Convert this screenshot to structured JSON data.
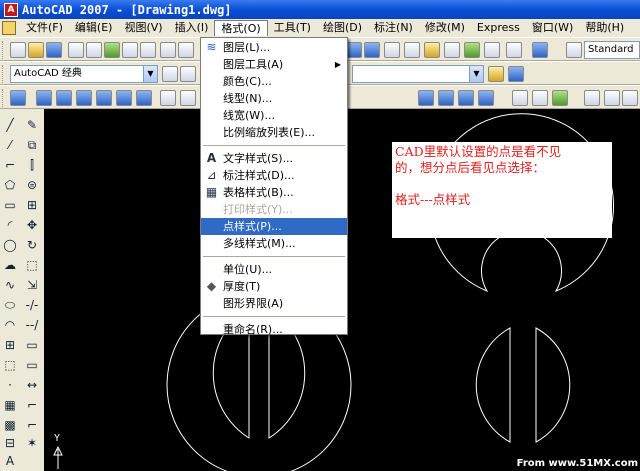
{
  "window": {
    "title": "AutoCAD 2007 - [Drawing1.dwg]"
  },
  "menubar": {
    "items": [
      {
        "label": "文件(F)"
      },
      {
        "label": "编辑(E)"
      },
      {
        "label": "视图(V)"
      },
      {
        "label": "插入(I)"
      },
      {
        "label": "格式(O)"
      },
      {
        "label": "工具(T)"
      },
      {
        "label": "绘图(D)"
      },
      {
        "label": "标注(N)"
      },
      {
        "label": "修改(M)"
      },
      {
        "label": "Express"
      },
      {
        "label": "窗口(W)"
      },
      {
        "label": "帮助(H)"
      }
    ],
    "active_index": 4
  },
  "toolbar": {
    "text_style_combo": "Standard",
    "workspace_combo": "AutoCAD 经典"
  },
  "format_menu": {
    "items": [
      {
        "label": "图层(L)...",
        "icon": "layers-icon",
        "disabled": false
      },
      {
        "label": "图层工具(A)",
        "icon": "",
        "disabled": false,
        "submenu": true
      },
      {
        "label": "颜色(C)...",
        "icon": "",
        "disabled": false
      },
      {
        "label": "线型(N)...",
        "icon": "",
        "disabled": false
      },
      {
        "label": "线宽(W)...",
        "icon": "",
        "disabled": false
      },
      {
        "label": "比例缩放列表(E)...",
        "icon": "",
        "disabled": false
      },
      {
        "label": "文字样式(S)...",
        "icon": "text-style-icon",
        "disabled": false,
        "sep_before": true
      },
      {
        "label": "标注样式(D)...",
        "icon": "dim-style-icon",
        "disabled": false
      },
      {
        "label": "表格样式(B)...",
        "icon": "table-style-icon",
        "disabled": false
      },
      {
        "label": "打印样式(Y)...",
        "icon": "",
        "disabled": true
      },
      {
        "label": "点样式(P)...",
        "icon": "",
        "disabled": false,
        "highlight": true
      },
      {
        "label": "多线样式(M)...",
        "icon": "",
        "disabled": false
      },
      {
        "label": "单位(U)...",
        "icon": "",
        "disabled": false,
        "sep_before": true
      },
      {
        "label": "厚度(T)",
        "icon": "thickness-icon",
        "disabled": false
      },
      {
        "label": "图形界限(A)",
        "icon": "",
        "disabled": false
      },
      {
        "label": "重命名(R)...",
        "icon": "",
        "disabled": false,
        "sep_before": true
      }
    ]
  },
  "annotation": {
    "line1": "CAD里默认设置的点是看不见",
    "line2": "的，想分点后看见点选择：",
    "line3": "格式---点样式"
  },
  "canvas": {
    "axis_y_label": "Y"
  },
  "watermark": "From www.51MX.com",
  "colors": {
    "titlebar": "#0a4fd6",
    "menu_highlight": "#316ac5",
    "annotation_text": "#e0201c",
    "canvas_bg": "#000000"
  }
}
